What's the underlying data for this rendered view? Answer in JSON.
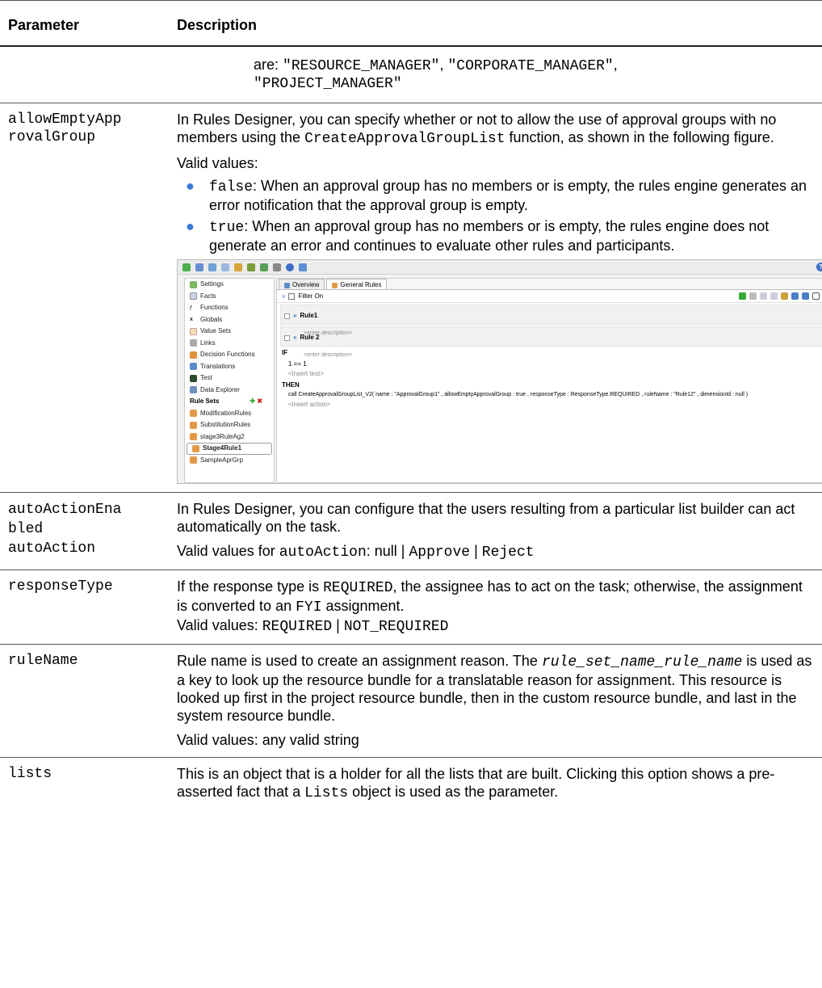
{
  "table": {
    "headers": {
      "param": "Parameter",
      "desc": "Description"
    },
    "row0": {
      "l1_a": "are: ",
      "l1_b": "\"RESOURCE_MANAGER\"",
      "l1_c": ", ",
      "l1_d": "\"CORPORATE_MANAGER\"",
      "l1_e": ",",
      "l2": "\"PROJECT_MANAGER\""
    },
    "row1": {
      "param_l1": "allowEmptyApp",
      "param_l2": "rovalGroup",
      "p1_a": "In Rules Designer, you can specify whether or not to allow the use of approval groups with no members using the ",
      "p1_code": "CreateApprovalGroupList",
      "p1_b": " function, as shown in the following figure.",
      "valid": "Valid values:",
      "b1_code": "false",
      "b1_text": ": When an approval group has no members or is empty, the rules engine generates an error notification that the approval group is empty.",
      "b2_code": "true",
      "b2_text": ": When an approval group has no members or is empty, the rules engine does not generate an error and continues to evaluate other rules and participants."
    },
    "row2": {
      "param_l1": "autoActionEna",
      "param_l2": "bled",
      "param_l3": "autoAction",
      "p1": "In Rules Designer, you can configure that the users resulting from a particular list builder can act automatically on the task.",
      "p2_a": "Valid values for ",
      "p2_code1": "autoAction",
      "p2_b": ": null | ",
      "p2_code2": "Approve",
      "p2_c": " | ",
      "p2_code3": "Reject"
    },
    "row3": {
      "param": "responseType",
      "p1_a": "If the response type is ",
      "p1_code": "REQUIRED",
      "p1_b": ", the assignee has to act on the task; otherwise, the assignment is converted to an ",
      "p1_code2": "FYI",
      "p1_c": " assignment.",
      "p2_a": "Valid values: ",
      "p2_code1": "REQUIRED",
      "p2_b": " | ",
      "p2_code2": "NOT_REQUIRED"
    },
    "row4": {
      "param": "ruleName",
      "p1_a": "Rule name is used to create an assignment reason. The ",
      "p1_code": "rule_set_name_rule_name",
      "p1_b": " is used as a key to look up the resource bundle for a translatable reason for assignment. This resource is looked up first in the project resource bundle, then in the custom resource bundle, and last in the system resource bundle.",
      "p2": "Valid values: any valid string"
    },
    "row5": {
      "param": "lists",
      "p1_a": "This is an object that is a holder for all the lists that are built. Clicking this option shows a pre-asserted fact that a ",
      "p1_code": "Lists",
      "p1_b": " object is used as the parameter."
    }
  },
  "screenshot": {
    "help": "?",
    "left_items": [
      "Settings",
      "Facts",
      "Functions",
      "Globals",
      "Value Sets",
      "Links",
      "Decision Functions",
      "Translations",
      "Test",
      "Data Explorer"
    ],
    "ruleset_header": "Rule Sets",
    "rulesets": [
      "ModificationRules",
      "SubstitutionRules",
      "stage3RuleAg2",
      "Stage4Rule1",
      "SampleAprGrp"
    ],
    "tab_overview": "Overview",
    "tab_general": "General Rules",
    "filter": "Filter On",
    "rule1": "Rule1",
    "rule2": "Rule 2",
    "enter_desc": "<enter description>",
    "if": "IF",
    "cond": "1 == 1",
    "insert_test": "<insert test>",
    "then": "THEN",
    "call": "call CreateApprovalGroupList_V2( name : \"ApprovalGroup1\" , allowEmptyApprovalGroup : true , responseType : ResponseType.REQUIRED , ruleName : \"Rule12\" , dimensionId : null )",
    "insert_action": "<insert action>"
  }
}
